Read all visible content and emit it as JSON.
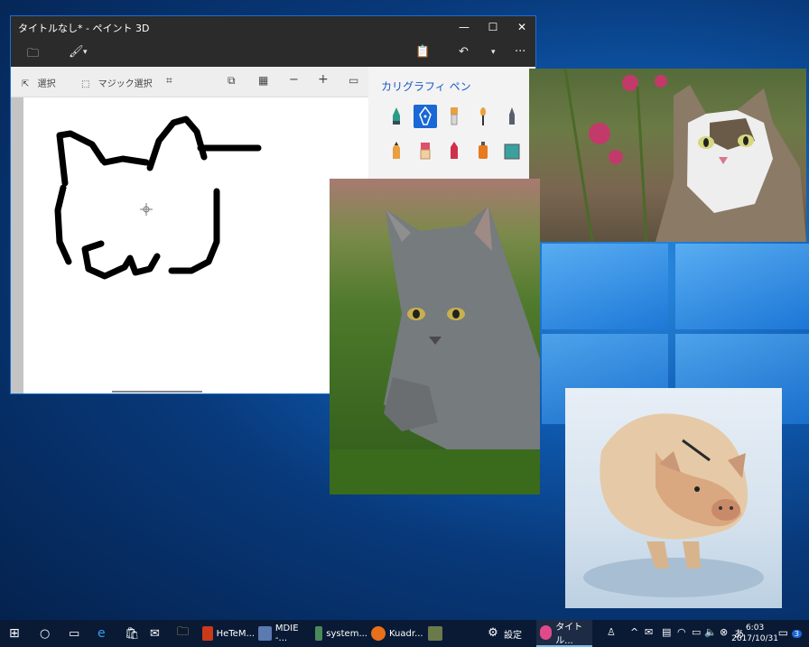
{
  "window": {
    "title": "タイトルなし* - ペイント 3D",
    "minimize": "—",
    "maximize": "☐",
    "close": "✕"
  },
  "menubar": {
    "folder_icon": "🗀",
    "brush_icon": "🖌",
    "dropdown": "▾",
    "paste_icon": "📋",
    "undo_icon": "↶",
    "more": "···"
  },
  "toolbar": {
    "select_label": "選択",
    "magic_select_label": "マジック選択"
  },
  "side_panel": {
    "title": "カリグラフィ ペン",
    "brushes": [
      {
        "name": "marker",
        "color": "#2b9a86"
      },
      {
        "name": "calligraphy-pen",
        "color": "#ffffff",
        "selected": true
      },
      {
        "name": "oil-brush",
        "color": "#e8a040"
      },
      {
        "name": "watercolor",
        "color": "#e8a040"
      },
      {
        "name": "pixel-pen",
        "color": "#556070"
      },
      {
        "name": "pencil",
        "color": "#e8a040"
      },
      {
        "name": "eraser",
        "color": "#e0506a"
      },
      {
        "name": "crayon",
        "color": "#d0304a"
      },
      {
        "name": "spray-can",
        "color": "#e87a20"
      },
      {
        "name": "fill-bucket",
        "color": "#3aa0a0"
      }
    ]
  },
  "taskbar": {
    "items": [
      {
        "label": "HeTeM..."
      },
      {
        "label": "MDIE -..."
      },
      {
        "label": "system..."
      },
      {
        "label": "Kuadr..."
      },
      {
        "label": "設定"
      },
      {
        "label": "タイトル..."
      }
    ],
    "time": "6:03",
    "date": "2017/10/31",
    "ime": "あ",
    "notifications": "3"
  },
  "colors": {
    "accent": "#1b57c4",
    "taskbar": "#0a1a35"
  }
}
